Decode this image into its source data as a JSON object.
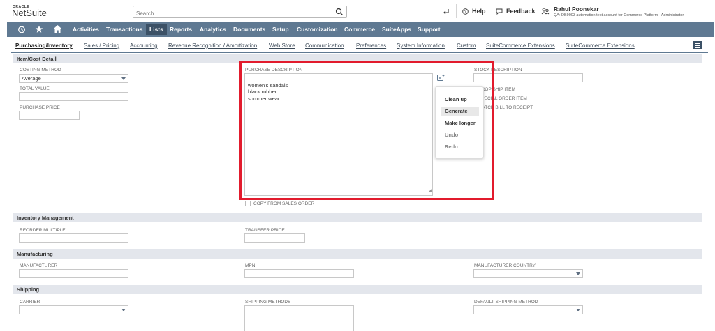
{
  "brand": {
    "oracle": "ORACLE",
    "netsuite": "NetSuite"
  },
  "search": {
    "placeholder": "Search"
  },
  "header": {
    "help": "Help",
    "feedback": "Feedback",
    "user_name": "Rahul Poonekar",
    "user_role": "QA: DB9003 automation test account for Commerce Platform - Administrator"
  },
  "nav": {
    "items": [
      "Activities",
      "Transactions",
      "Lists",
      "Reports",
      "Analytics",
      "Documents",
      "Setup",
      "Customization",
      "Commerce",
      "SuiteApps",
      "Support"
    ],
    "active": "Lists"
  },
  "subtabs": {
    "items": [
      "Purchasing/Inventory",
      "Sales / Pricing",
      "Accounting",
      "Revenue Recognition / Amortization",
      "Web Store",
      "Communication",
      "Preferences",
      "System Information",
      "Custom",
      "SuiteCommerce Extensions",
      "SuiteCommerce Extensions"
    ]
  },
  "sections": {
    "item_cost": "Item/Cost Detail",
    "inventory": "Inventory Management",
    "manufacturing": "Manufacturing",
    "shipping": "Shipping"
  },
  "fields": {
    "costing_method_label": "COSTING METHOD",
    "costing_method_value": "Average",
    "total_value_label": "TOTAL VALUE",
    "purchase_price_label": "PURCHASE PRICE",
    "purchase_description_label": "PURCHASE DESCRIPTION",
    "purchase_description_value": "women's sandals\nblack rubber\nsummer wear",
    "copy_from_sales_order": "COPY FROM SALES ORDER",
    "stock_description_label": "STOCK DESCRIPTION",
    "drop_ship_item": "DROP SHIP ITEM",
    "special_order_item": "SPECIAL ORDER ITEM",
    "match_bill": "MATCH BILL TO RECEIPT",
    "reorder_multiple_label": "REORDER MULTIPLE",
    "transfer_price_label": "TRANSFER PRICE",
    "manufacturer_label": "MANUFACTURER",
    "mpn_label": "MPN",
    "manufacturer_country_label": "MANUFACTURER COUNTRY",
    "carrier_label": "CARRIER",
    "shipping_methods_label": "SHIPPING METHODS",
    "default_shipping_method_label": "DEFAULT SHIPPING METHOD"
  },
  "ai_menu": {
    "items": [
      "Clean up",
      "Generate",
      "Make longer",
      "Undo",
      "Redo"
    ]
  },
  "colors": {
    "nav_bg": "#5f7992",
    "nav_active": "#3c5166",
    "section_bg": "#e3e6ec",
    "highlight": "#e21b2d"
  }
}
